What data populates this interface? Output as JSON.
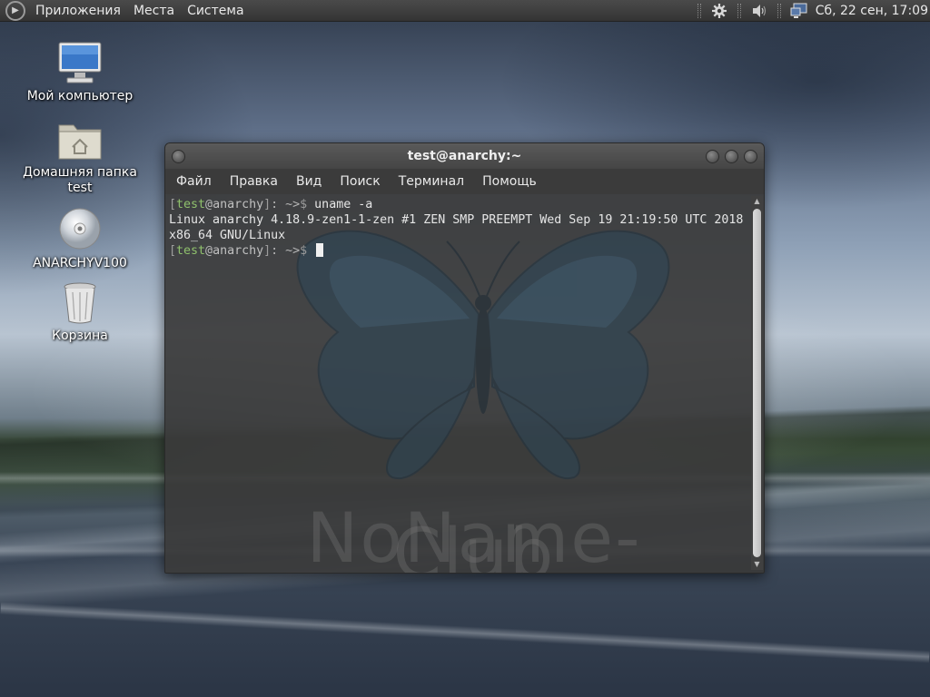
{
  "panel": {
    "menus": [
      "Приложения",
      "Места",
      "Система"
    ],
    "clock": "Сб, 22 сен, 17:09",
    "tray_icons": [
      "update-gear-icon",
      "volume-icon",
      "network-icon"
    ]
  },
  "desktop": {
    "icons": [
      {
        "label": "Мой компьютер",
        "icon": "computer-icon"
      },
      {
        "label": "Домашняя папка test",
        "icon": "home-folder-icon"
      },
      {
        "label": "ANARCHYV100",
        "icon": "disc-icon"
      },
      {
        "label": "Корзина",
        "icon": "trash-icon"
      }
    ]
  },
  "terminal": {
    "title": "test@anarchy:~",
    "menu": [
      "Файл",
      "Правка",
      "Вид",
      "Поиск",
      "Терминал",
      "Помощь"
    ],
    "prompt": {
      "open": "[",
      "user": "test",
      "at": "@",
      "host": "anarchy",
      "close": "]",
      "path": ": ~>",
      "dollar": "$"
    },
    "command": " uname -a",
    "output_1": "Linux anarchy 4.18.9-zen1-1-zen #1 ZEN SMP PREEMPT Wed Sep 19 21:19:50 UTC 2018",
    "output_2": "x86_64 GNU/Linux",
    "watermark": "NoName-Club"
  }
}
